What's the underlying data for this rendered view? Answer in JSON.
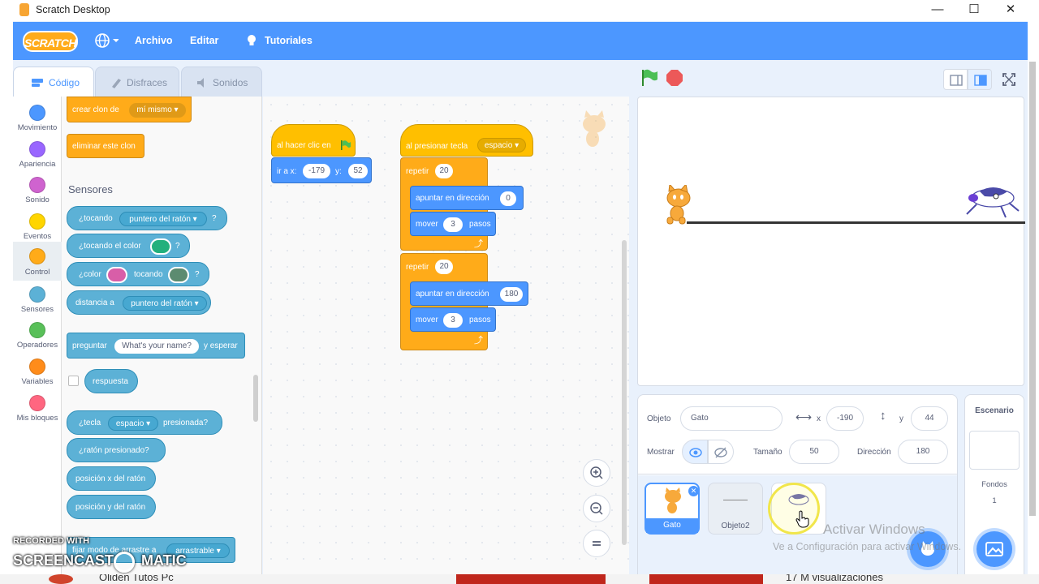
{
  "window": {
    "title": "Scratch Desktop",
    "min": "—",
    "max": "☐",
    "close": "✕"
  },
  "menubar": {
    "logo": "SCRATCH",
    "file": "Archivo",
    "edit": "Editar",
    "tutorials": "Tutoriales"
  },
  "tabs": {
    "code": "Código",
    "costumes": "Disfraces",
    "sounds": "Sonidos"
  },
  "categories": [
    {
      "label": "Movimiento",
      "color": "#4c97ff"
    },
    {
      "label": "Apariencia",
      "color": "#9966ff"
    },
    {
      "label": "Sonido",
      "color": "#cf63cf"
    },
    {
      "label": "Eventos",
      "color": "#ffd500"
    },
    {
      "label": "Control",
      "color": "#ffab19"
    },
    {
      "label": "Sensores",
      "color": "#5cb1d6"
    },
    {
      "label": "Operadores",
      "color": "#59c059"
    },
    {
      "label": "Variables",
      "color": "#ff8c1a"
    },
    {
      "label": "Mis bloques",
      "color": "#ff6680"
    }
  ],
  "palette": {
    "create_clone": "crear clon de",
    "create_clone_opt": "mí mismo ▾",
    "delete_clone": "eliminar este clon",
    "sensing_title": "Sensores",
    "touching": "¿tocando",
    "touching_opt": "puntero del ratón ▾",
    "q": "?",
    "touching_color": "¿tocando el color",
    "color": "¿color",
    "touching_word": "tocando",
    "distance": "distancia a",
    "distance_opt": "puntero del ratón ▾",
    "ask": "preguntar",
    "ask_default": "What's your name?",
    "ask_wait": "y esperar",
    "answer": "respuesta",
    "key": "¿tecla",
    "key_opt": "espacio ▾",
    "key_pressed": "presionada?",
    "mouse_down": "¿ratón presionado?",
    "mouse_x": "posición x del ratón",
    "mouse_y": "posición y del ratón",
    "drag_mode": "fijar modo de arrastre a",
    "drag_opt": "arrastrable ▾"
  },
  "script1": {
    "hat": "al hacer clic en",
    "goto": "ir a x:",
    "x": "-179",
    "y_label": "y:",
    "y": "52"
  },
  "script2": {
    "hat": "al presionar tecla",
    "key": "espacio ▾",
    "repeat1": "repetir",
    "repeat1_n": "20",
    "point1": "apuntar en dirección",
    "point1_v": "0",
    "move1": "mover",
    "move1_v": "3",
    "steps1": "pasos",
    "repeat2": "repetir",
    "repeat2_n": "20",
    "point2": "apuntar en dirección",
    "point2_v": "180",
    "move2": "mover",
    "move2_v": "3",
    "steps2": "pasos"
  },
  "sprite_info": {
    "sprite_label": "Objeto",
    "sprite_name": "Gato",
    "x_label": "x",
    "x": "-190",
    "y_label": "y",
    "y": "44",
    "show_label": "Mostrar",
    "size_label": "Tamaño",
    "size": "50",
    "direction_label": "Dirección",
    "direction": "180"
  },
  "sprites": [
    {
      "name": "Gato"
    },
    {
      "name": "Objeto2"
    },
    {
      "name": ""
    }
  ],
  "stage_pane": {
    "title": "Escenario",
    "backdrops_label": "Fondos",
    "backdrops_count": "1"
  },
  "overlay": {
    "recorded": "RECORDED WITH",
    "brand": "SCREENCAST",
    "brand2": "MATIC",
    "activate1": "Activar Windows",
    "activate2": "Ve a Configuración para activar Windows."
  },
  "bottom_strip": {
    "left": "Oliden Tutos Pc",
    "right": "17 M visualizaciones"
  },
  "colors": {
    "accent": "#4c97ff",
    "control": "#ffab19",
    "events": "#ffbf00",
    "motion": "#4c97ff",
    "sensing": "#5cb1d6"
  },
  "icons": [
    "globe-icon",
    "lightbulb-icon",
    "green-flag-icon",
    "stop-icon",
    "eye-icon",
    "hidden-eye-icon",
    "zoom-in-icon",
    "zoom-out-icon",
    "reset-zoom-icon",
    "add-sprite-icon",
    "add-backdrop-icon"
  ]
}
